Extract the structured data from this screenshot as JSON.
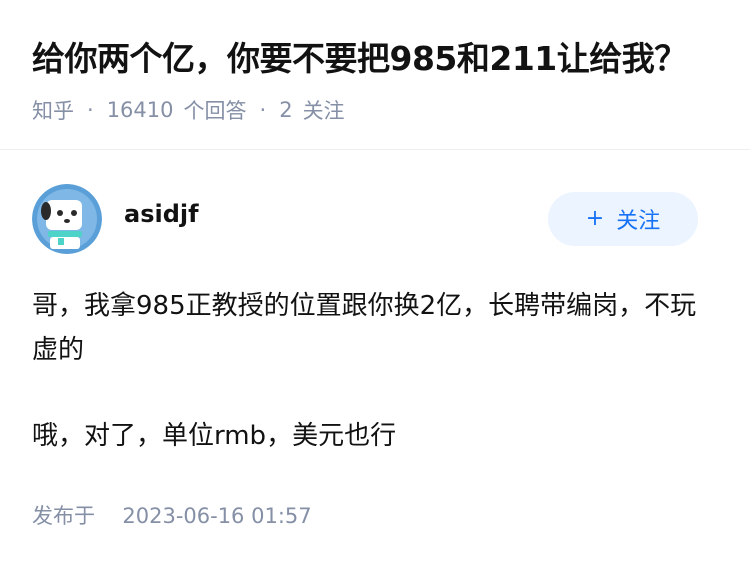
{
  "question": {
    "title": "给你两个亿，你要不要把985和211让给我？",
    "source": "知乎",
    "answer_count": "16410",
    "answer_label": "个回答",
    "follow_count": "2",
    "follow_label": "关注"
  },
  "answer": {
    "author": {
      "name": "asidjf",
      "avatar": "cartoon-dog-avatar"
    },
    "follow_button_label": "关注",
    "paragraphs": [
      "哥，我拿985正教授的位置跟你换2亿，长聘带编岗，不玩虚的",
      "哦，对了，单位rmb，美元也行"
    ],
    "published_label": "发布于",
    "published_time": "2023-06-16 01:57"
  },
  "colors": {
    "accent": "#1772f6",
    "follow_button_bg": "#ebf4ff",
    "meta_text": "#8590a6",
    "text": "#121212",
    "avatar_bg": "#5a9fd8"
  }
}
